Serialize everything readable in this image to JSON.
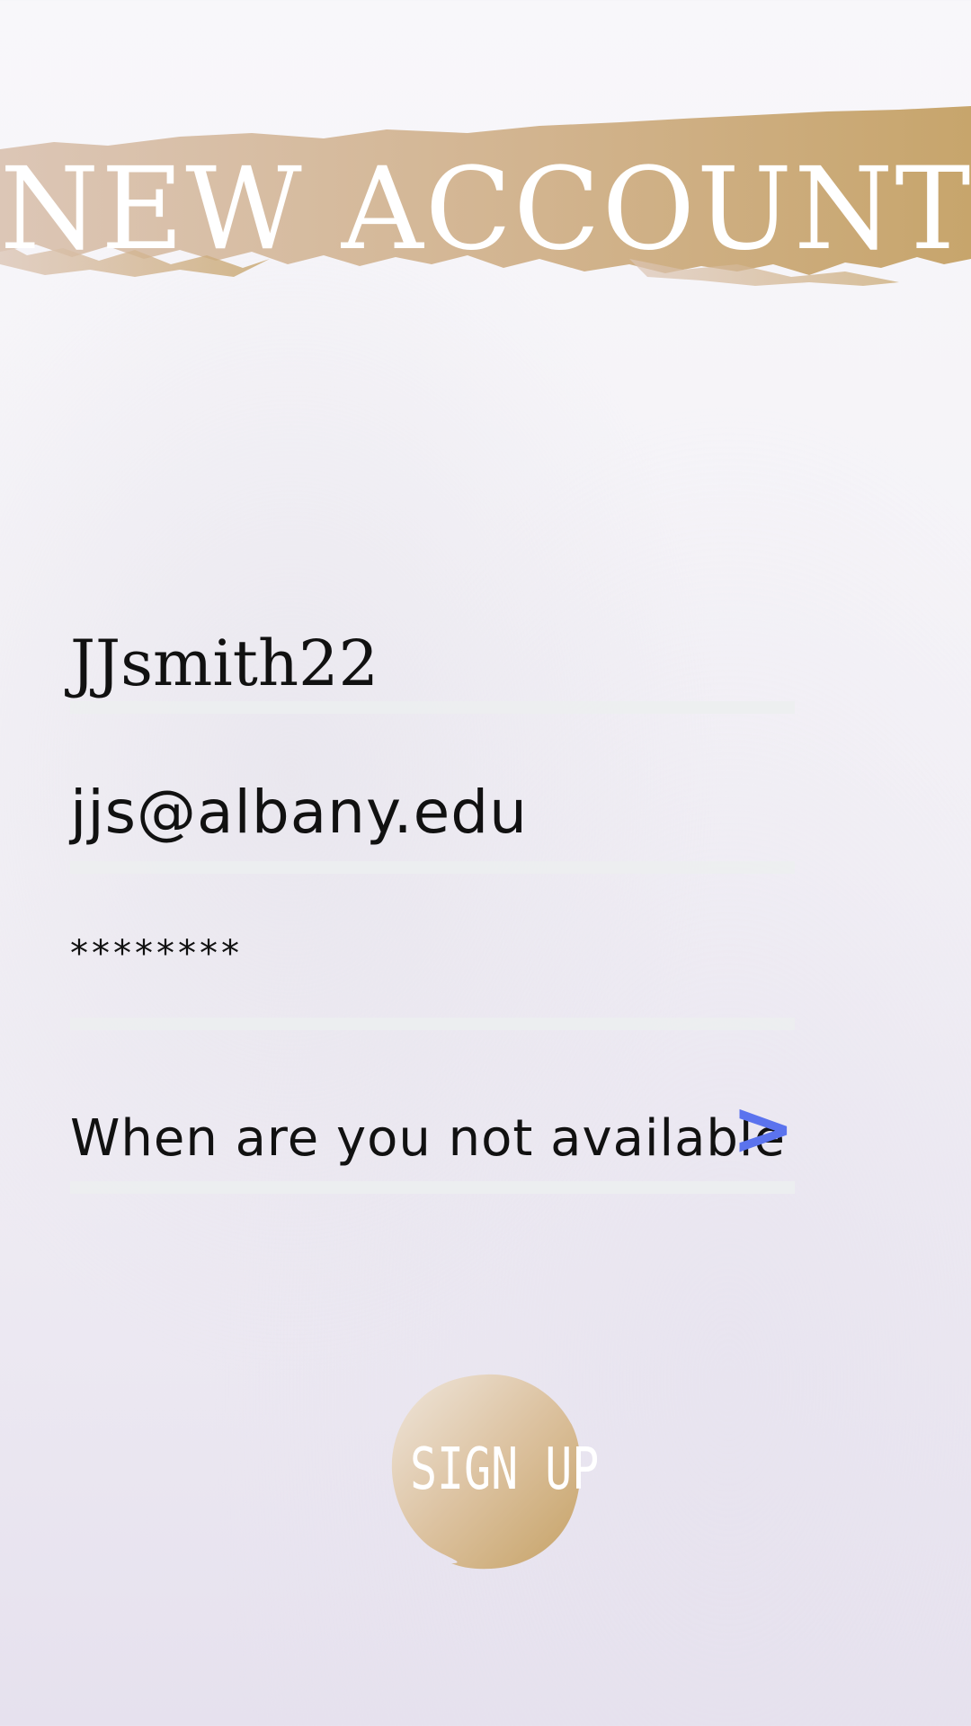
{
  "header": {
    "title": "NEW ACCOUNT"
  },
  "form": {
    "username": {
      "value": "JJsmith22"
    },
    "email": {
      "value": "jjs@albany.edu"
    },
    "password": {
      "value": "********"
    },
    "availability": {
      "label": "When are you not available",
      "chevron": ">"
    }
  },
  "actions": {
    "signup_label": "SIGN UP"
  },
  "colors": {
    "gold_light": "#dcc6b0",
    "gold_dark": "#c9a872",
    "accent_blue": "#5b73ee",
    "background": "#f4f2f7"
  },
  "icons": {
    "availability_chevron": "chevron-right-icon"
  }
}
